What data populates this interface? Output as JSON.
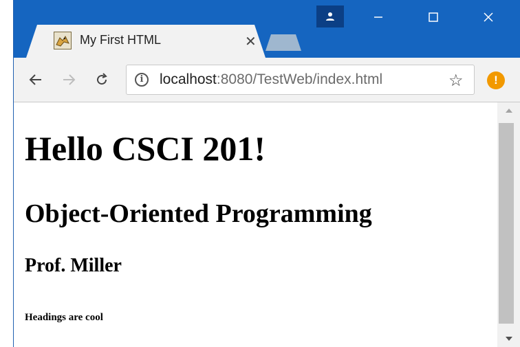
{
  "browser": {
    "tab": {
      "title": "My First HTML",
      "close": "✕"
    },
    "window_controls": {
      "minimize": "—",
      "maximize": "☐",
      "close": "✕"
    },
    "nav": {
      "back": "←",
      "forward": "→",
      "reload": "C"
    },
    "address": {
      "host": "localhost",
      "path": ":8080/TestWeb/index.html"
    },
    "star": "☆",
    "alert": "!"
  },
  "page": {
    "h1": "Hello CSCI 201!",
    "h2": "Object-Oriented Programming",
    "h3": "Prof. Miller",
    "h6": "Headings are cool"
  },
  "colors": {
    "titlebar": "#1565c0",
    "tab": "#f2f2f2",
    "alert": "#f29900"
  },
  "icons": {
    "profile": "person-icon",
    "favicon": "tomcat-icon",
    "info": "info-icon",
    "bookmark": "star-icon"
  }
}
